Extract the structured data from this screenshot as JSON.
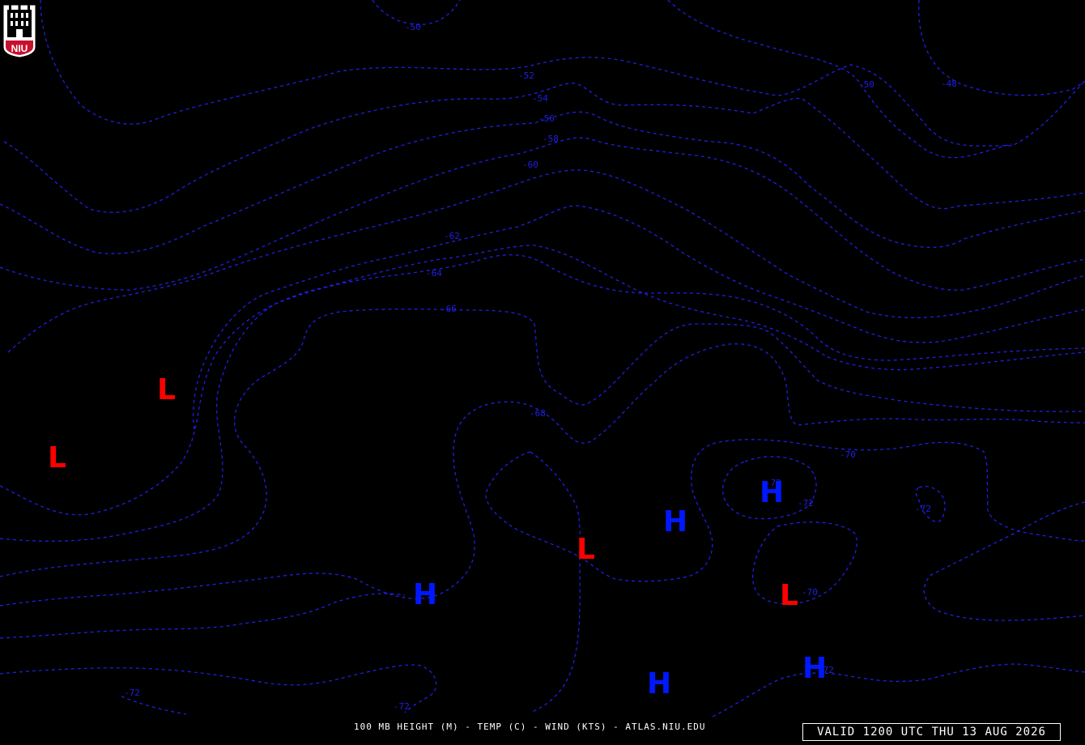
{
  "logo": {
    "text": "NIU"
  },
  "contour_labels": [
    "-50",
    "-52",
    "-54",
    "-56",
    "-58",
    "-60",
    "-62",
    "-64",
    "-66",
    "-68",
    "-70",
    "-72",
    "-72",
    "-72",
    "-72",
    "-70",
    "-72",
    "-72",
    "-50",
    "-48"
  ],
  "pressure_centers": [
    "L",
    "L",
    "L",
    "L",
    "H",
    "H",
    "H",
    "H",
    "H"
  ],
  "footer": {
    "caption": "100 MB HEIGHT (M) - TEMP (C) - WIND (KTS) - ATLAS.NIU.EDU",
    "valid": "VALID 1200 UTC THU 13 AUG 2026"
  },
  "colors": {
    "background": "#000000",
    "contour": "#1f1fe6",
    "low_center": "#ff0000",
    "high_center": "#0018ff",
    "logo_red": "#c8102e"
  }
}
